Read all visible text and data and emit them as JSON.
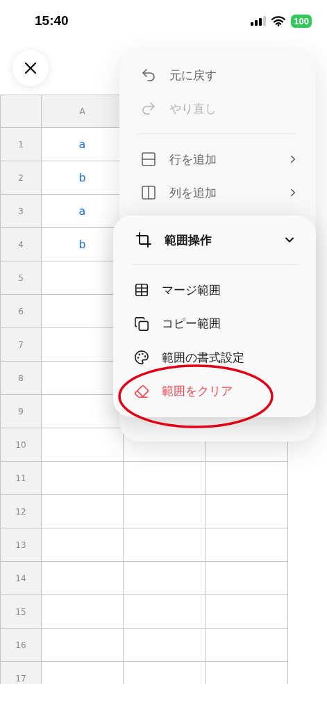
{
  "status_bar": {
    "time": "15:40",
    "battery": "100"
  },
  "sheet": {
    "columns": [
      "A"
    ],
    "rows": [
      {
        "number": "1",
        "cells": [
          "a"
        ]
      },
      {
        "number": "2",
        "cells": [
          "b"
        ]
      },
      {
        "number": "3",
        "cells": [
          "a"
        ]
      },
      {
        "number": "4",
        "cells": [
          "b"
        ]
      },
      {
        "number": "5",
        "cells": []
      },
      {
        "number": "6",
        "cells": []
      },
      {
        "number": "7",
        "cells": []
      },
      {
        "number": "8",
        "cells": []
      },
      {
        "number": "9",
        "cells": []
      },
      {
        "number": "10",
        "cells": []
      },
      {
        "number": "11",
        "cells": []
      },
      {
        "number": "12",
        "cells": []
      },
      {
        "number": "13",
        "cells": []
      },
      {
        "number": "14",
        "cells": []
      },
      {
        "number": "15",
        "cells": []
      },
      {
        "number": "16",
        "cells": []
      },
      {
        "number": "17",
        "cells": []
      }
    ]
  },
  "menu": {
    "items": [
      {
        "kind": "action",
        "label": "元に戻す",
        "disabled": false
      },
      {
        "kind": "action",
        "label": "やり直し",
        "disabled": true
      },
      {
        "kind": "divider"
      },
      {
        "kind": "submenu",
        "label": "行を追加",
        "disabled": false
      },
      {
        "kind": "submenu",
        "label": "列を追加",
        "disabled": false
      },
      {
        "kind": "hidden"
      }
    ]
  },
  "submenu": {
    "title": "範囲操作",
    "expanded": true,
    "items": [
      {
        "label": "マージ範囲",
        "destructive": false
      },
      {
        "label": "コピー範囲",
        "destructive": false
      },
      {
        "label": "範囲の書式設定",
        "destructive": false
      },
      {
        "label": "範囲をクリア",
        "destructive": true
      }
    ]
  }
}
